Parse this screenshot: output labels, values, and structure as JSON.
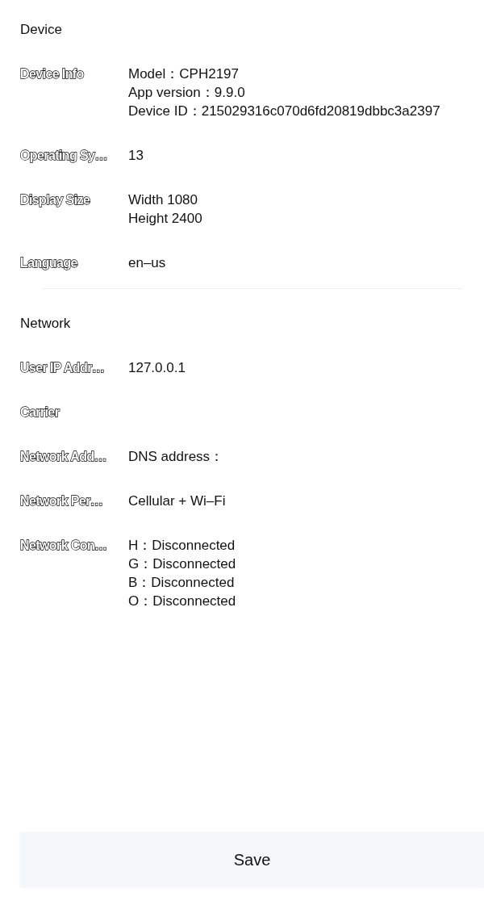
{
  "sections": [
    {
      "title": "Device",
      "rows": [
        {
          "label": "Device Info",
          "values": [
            "Model：CPH2197",
            "App version：9.9.0",
            "Device ID：215029316c070d6fd20819dbbc3a2397"
          ]
        },
        {
          "label": "Operating Sy…",
          "values": [
            "13"
          ]
        },
        {
          "label": "Display Size",
          "values": [
            "Width 1080",
            "Height 2400"
          ]
        },
        {
          "label": "Language",
          "values": [
            "en–us"
          ]
        }
      ]
    },
    {
      "title": "Network",
      "rows": [
        {
          "label": "User IP Addr…",
          "values": [
            "127.0.0.1"
          ]
        },
        {
          "label": "Carrier",
          "values": []
        },
        {
          "label": "Network Add…",
          "values": [
            "DNS address："
          ]
        },
        {
          "label": "Network Per…",
          "values": [
            "Cellular + Wi–Fi"
          ]
        },
        {
          "label": "Network Con…",
          "values": [
            "H：Disconnected",
            "G：Disconnected",
            "B：Disconnected",
            "O：Disconnected"
          ]
        }
      ]
    }
  ],
  "save_button": "Save"
}
